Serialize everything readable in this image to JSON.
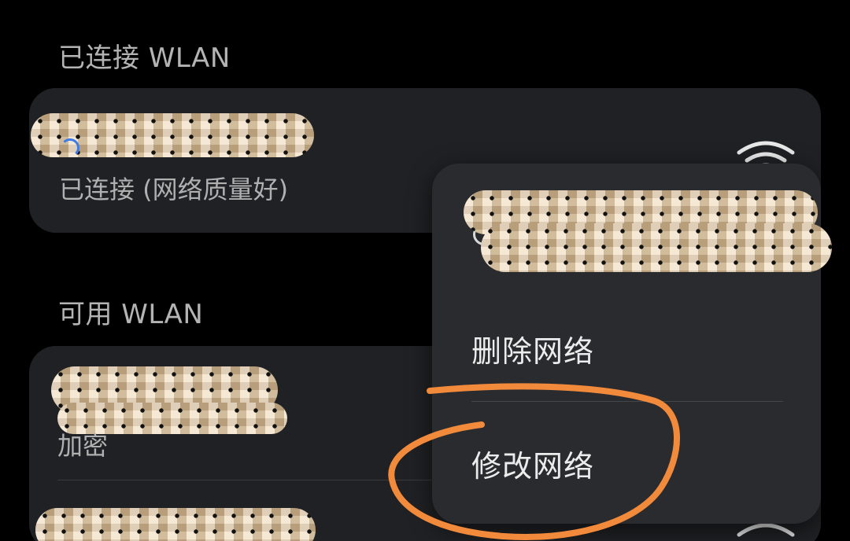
{
  "connected_section": {
    "header": "已连接 WLAN",
    "network": {
      "status": "已连接 (网络质量好)",
      "signal_icon": "wifi-full-icon"
    }
  },
  "available_section": {
    "header": "可用 WLAN",
    "networks": [
      {
        "status": "加密"
      }
    ]
  },
  "popup_menu": {
    "items": [
      "删除网络",
      "修改网络"
    ]
  },
  "colors": {
    "background": "#000000",
    "card": "#202124",
    "popup": "#2a2b2e",
    "annotation": "#f28a3c",
    "accent": "#3d7bea"
  }
}
